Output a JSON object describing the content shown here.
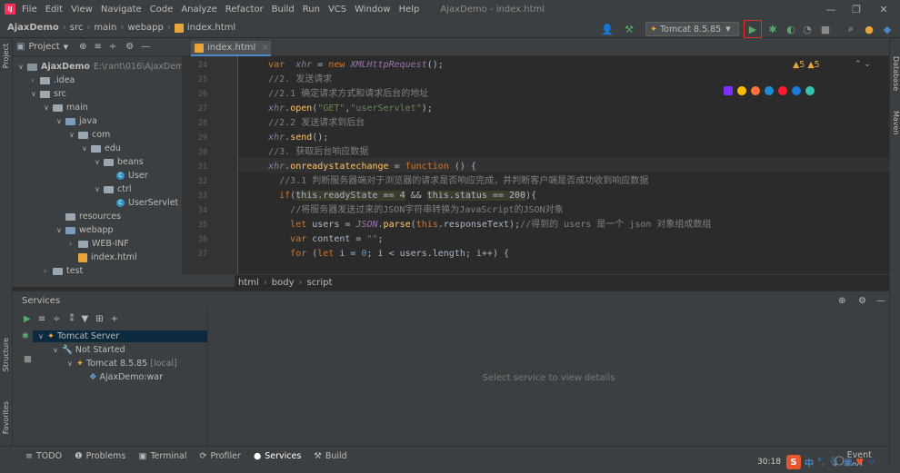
{
  "menu": {
    "items": [
      "File",
      "Edit",
      "View",
      "Navigate",
      "Code",
      "Analyze",
      "Refactor",
      "Build",
      "Run",
      "VCS",
      "Window",
      "Help"
    ],
    "window_title": "AjaxDemo - index.html"
  },
  "nav": {
    "crumbs": [
      "AjaxDemo",
      "src",
      "main",
      "webapp",
      "index.html"
    ],
    "run_config": "Tomcat 8.5.85"
  },
  "project": {
    "title": "Project",
    "root_name": "AjaxDemo",
    "root_path": "E:\\rant\\016\\AjaxDem",
    "items": [
      ".idea",
      "src",
      "main",
      "java",
      "com",
      "edu",
      "beans",
      "User",
      "ctrl",
      "UserServlet",
      "resources",
      "webapp",
      "WEB-INF",
      "index.html",
      "test"
    ]
  },
  "editor": {
    "tab": "index.html",
    "warnings": "▲5  ▲5",
    "line_numbers": [
      "24",
      "25",
      "26",
      "27",
      "28",
      "29",
      "30",
      "31",
      "32",
      "33",
      "34",
      "35",
      "36",
      "37"
    ],
    "lines": [
      {
        "pre": "    ",
        "parts": [
          [
            "kw",
            "var"
          ],
          [
            "",
            "  "
          ],
          [
            "it",
            "xhr"
          ],
          [
            "",
            " = "
          ],
          [
            "kw",
            "new"
          ],
          [
            "",
            " "
          ],
          [
            "it",
            "XMLHttpRequest"
          ],
          [
            "",
            "();"
          ]
        ]
      },
      {
        "pre": "    ",
        "parts": [
          [
            "cm",
            "//2. 发送请求"
          ]
        ]
      },
      {
        "pre": "    ",
        "parts": [
          [
            "cm",
            "//2.1 确定请求方式和请求后台的地址"
          ]
        ]
      },
      {
        "pre": "    ",
        "parts": [
          [
            "it",
            "xhr"
          ],
          [
            "",
            "."
          ],
          [
            "fn",
            "open"
          ],
          [
            "",
            "("
          ],
          [
            "str",
            "\"GET\""
          ],
          [
            "",
            ","
          ],
          [
            "str",
            "\"userServlet\""
          ],
          [
            "",
            ");"
          ]
        ]
      },
      {
        "pre": "    ",
        "parts": [
          [
            "cm",
            "//2.2 发送请求到后台"
          ]
        ]
      },
      {
        "pre": "    ",
        "parts": [
          [
            "it",
            "xhr"
          ],
          [
            "",
            "."
          ],
          [
            "fn",
            "send"
          ],
          [
            "",
            "();"
          ]
        ]
      },
      {
        "pre": "    ",
        "parts": [
          [
            "cm",
            "//3. 获取后台响应数据"
          ]
        ]
      },
      {
        "pre": "    ",
        "parts": [
          [
            "it",
            "xhr"
          ],
          [
            "",
            "."
          ],
          [
            "fn",
            "onreadystatechange"
          ],
          [
            "",
            " = "
          ],
          [
            "kw",
            "function"
          ],
          [
            "",
            " () {"
          ]
        ]
      },
      {
        "pre": "      ",
        "parts": [
          [
            "cm",
            "//3.1 判断服务器端对于浏览器的请求是否响应完成，并判断客户端是否成功收到响应数据"
          ]
        ]
      },
      {
        "pre": "      ",
        "parts": [
          [
            "kw",
            "if"
          ],
          [
            "",
            "("
          ],
          [
            "hl",
            "this.readyState == 4"
          ],
          [
            "",
            " && "
          ],
          [
            "hl",
            "this.status == 200"
          ],
          [
            "",
            "){"
          ]
        ]
      },
      {
        "pre": "        ",
        "parts": [
          [
            "cm",
            "//将服务器发送过来的JSON字符串转换为JavaScript的JSON对象"
          ]
        ]
      },
      {
        "pre": "        ",
        "parts": [
          [
            "kw",
            "let"
          ],
          [
            "",
            " users = "
          ],
          [
            "it",
            "JSON"
          ],
          [
            "",
            "."
          ],
          [
            "fn",
            "parse"
          ],
          [
            "",
            "("
          ],
          [
            "kw",
            "this"
          ],
          [
            "",
            ".responseText);"
          ],
          [
            "cm",
            "//得到的 users 是一个 json 对象组成数组"
          ]
        ]
      },
      {
        "pre": "        ",
        "parts": [
          [
            "kw",
            "var"
          ],
          [
            "",
            " content = "
          ],
          [
            "str",
            "\"\""
          ],
          [
            "",
            ";"
          ]
        ]
      },
      {
        "pre": "        ",
        "parts": [
          [
            "kw",
            "for"
          ],
          [
            "",
            " ("
          ],
          [
            "kw",
            "let"
          ],
          [
            "",
            " i = "
          ],
          [
            "num",
            "0"
          ],
          [
            "",
            "; i < users.length; i++) {"
          ]
        ]
      }
    ],
    "breadcrumb": [
      "html",
      "body",
      "script"
    ]
  },
  "services": {
    "title": "Services",
    "tree": [
      "Tomcat Server",
      "Not Started",
      "Tomcat 8.5.85",
      "[local]",
      "AjaxDemo:war"
    ],
    "detail_placeholder": "Select service to view details"
  },
  "bottom_tabs": [
    "TODO",
    "Problems",
    "Terminal",
    "Profiler",
    "Services",
    "Build"
  ],
  "side_labels": {
    "project": "Project",
    "structure": "Structure",
    "favorites": "Favorites",
    "database": "Database",
    "maven": "Maven",
    "event_log": "Event Log"
  },
  "tray": {
    "time": "30:18",
    "ime": "中"
  },
  "colors": {
    "accent": "#4a88c7",
    "run_green": "#59a869",
    "highlight_box": "#e0301e"
  }
}
